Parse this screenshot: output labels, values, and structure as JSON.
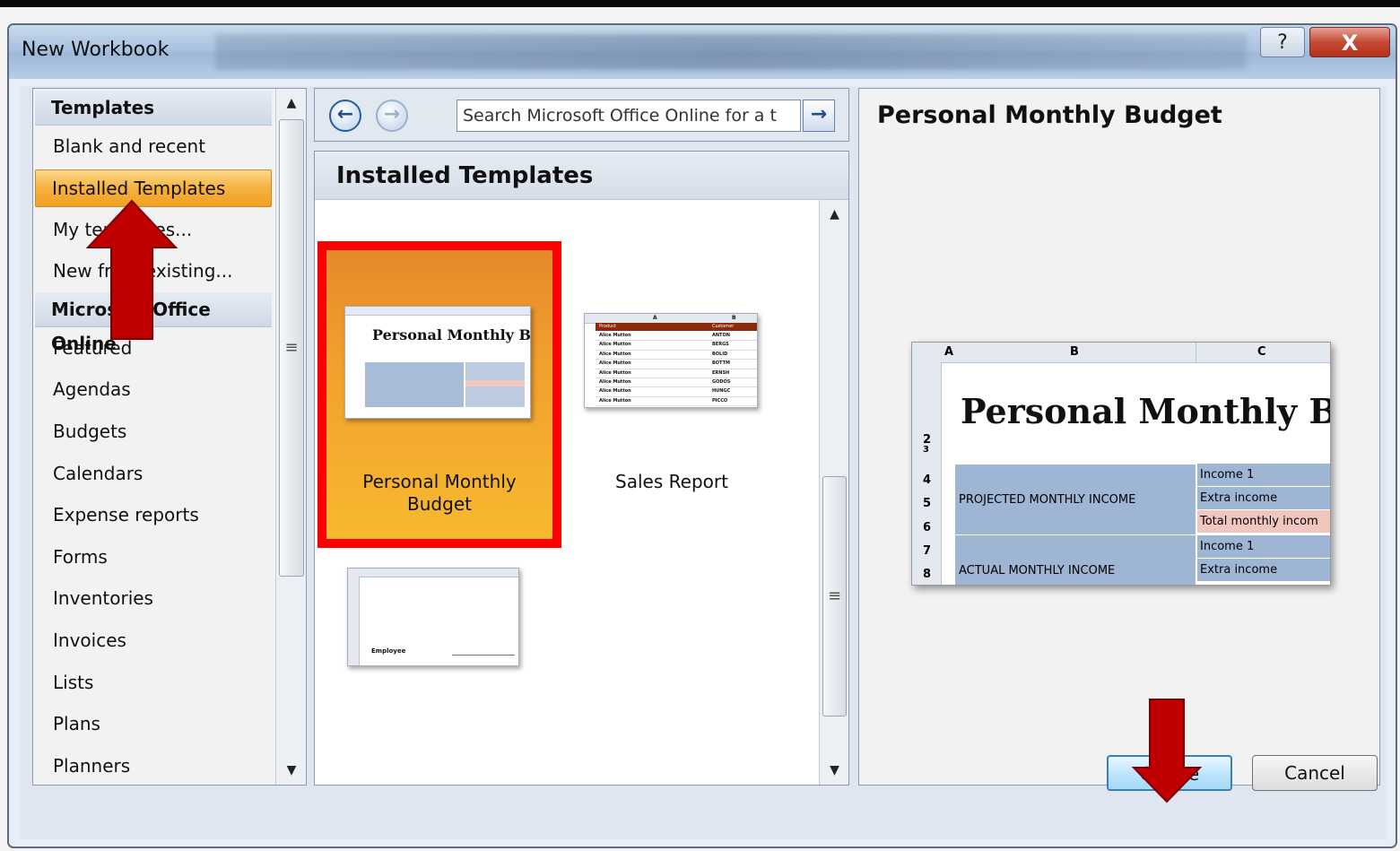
{
  "window": {
    "title": "New Workbook",
    "help_label": "?",
    "close_label": "X"
  },
  "sidebar": {
    "sections": [
      {
        "header": "Templates",
        "items": [
          "Blank and recent",
          "Installed Templates",
          "My templates...",
          "New from existing..."
        ]
      },
      {
        "header": "Microsoft Office Online",
        "items": [
          "Featured",
          "Agendas",
          "Budgets",
          "Calendars",
          "Expense reports",
          "Forms",
          "Inventories",
          "Invoices",
          "Lists",
          "Plans",
          "Planners"
        ]
      }
    ],
    "selected": "Installed Templates"
  },
  "search": {
    "value": "Search Microsoft Office Online for a t",
    "back_icon": "back-arrow-icon",
    "forward_icon": "forward-arrow-icon",
    "go_icon": "go-arrow-icon"
  },
  "installed": {
    "heading": "Installed Templates",
    "templates": [
      {
        "name": "Personal Monthly Budget",
        "line1": "Personal Monthly",
        "line2": "Budget",
        "thumb_title": "Personal Monthly Bu",
        "selected": true
      },
      {
        "name": "Sales Report",
        "line1": "Sales Report",
        "line2": "",
        "selected": false
      },
      {
        "name": "",
        "line1": "",
        "line2": "",
        "selected": false
      }
    ],
    "sales_thumb": {
      "col_a": "A",
      "col_b": "B",
      "head_a": "Product",
      "head_b": "Customer",
      "rows": [
        "Alice Mutton",
        "Alice Mutton",
        "Alice Mutton",
        "Alice Mutton",
        "Alice Mutton",
        "Alice Mutton",
        "Alice Mutton",
        "Alice Mutton",
        "Alice Mutton"
      ],
      "customers": [
        "ANTON",
        "BERGS",
        "BOLID",
        "BOTTM",
        "ERNSH",
        "GODOS",
        "HUNGC",
        "PICCO",
        ""
      ]
    },
    "timesheet_thumb": {
      "label": "Employee"
    }
  },
  "preview": {
    "title": "Personal Monthly Budget",
    "sheet": {
      "columns": [
        "A",
        "B",
        "C"
      ],
      "heading": "Personal Monthly Bud",
      "row_numbers": [
        "2",
        "3",
        "4",
        "5",
        "6",
        "7",
        "8"
      ],
      "projected_label": "PROJECTED MONTHLY INCOME",
      "actual_label": "ACTUAL MONTHLY INCOME",
      "income_1": "Income 1",
      "extra_income": "Extra income",
      "total_income": "Total monthly incom",
      "income_1b": "Income 1",
      "extra_income_b": "Extra income"
    }
  },
  "buttons": {
    "create": "Create",
    "cancel": "Cancel"
  },
  "colors": {
    "selected_highlight": "#f5b13f",
    "annotation_red": "#ff0000",
    "arrow_red": "#c00000"
  }
}
